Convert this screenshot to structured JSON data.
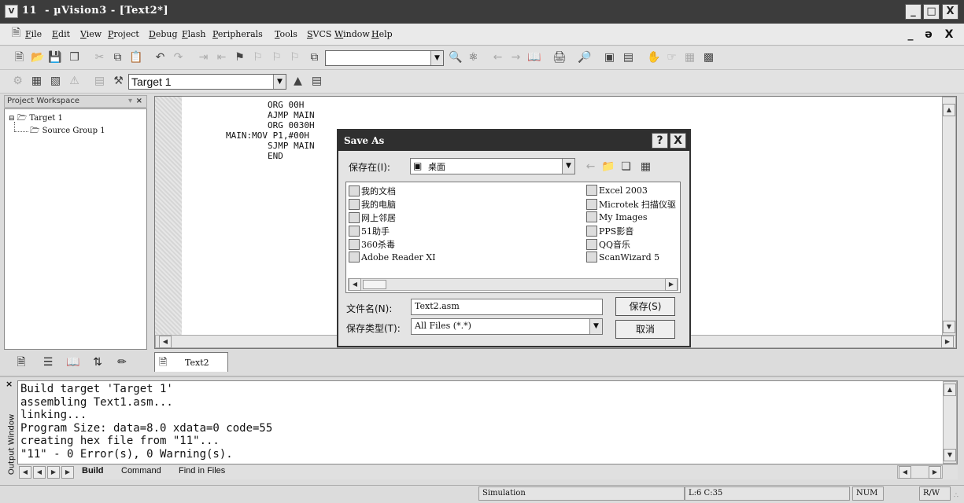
{
  "app": {
    "title": "11  - µVision3 - [Text2*]",
    "icon": "uvision-app-icon"
  },
  "window_controls": {
    "minimize": "_",
    "maximize": "□",
    "close": "X"
  },
  "menu": {
    "items": [
      "File",
      "Edit",
      "View",
      "Project",
      "Debug",
      "Flash",
      "Peripherals",
      "Tools",
      "SVCS",
      "Window",
      "Help"
    ],
    "mdi_controls": {
      "minimize": "_",
      "restore": "ə",
      "close": "X"
    }
  },
  "toolbar2": {
    "target_value": "Target 1"
  },
  "workspace": {
    "header": "Project Workspace",
    "tree": {
      "root": "Target 1",
      "child": "Source Group 1"
    },
    "tabs": [
      "files-tab",
      "regs-tab",
      "books-tab",
      "functions-tab",
      "templates-tab"
    ]
  },
  "editor": {
    "code": [
      "        ORG 00H",
      "        AJMP MAIN",
      "        ORG 0030H",
      "MAIN:MOV P1,#00H",
      "        SJMP MAIN",
      "        END"
    ],
    "doc_tab": "Text2"
  },
  "save_dialog": {
    "title": "Save As",
    "title_help": "?",
    "title_close": "X",
    "look_in_label": "保存在(I):",
    "look_in_value": "桌面",
    "left_items": [
      "我的文档",
      "我的电脑",
      "网上邻居",
      "51助手",
      "360杀毒",
      "Adobe Reader XI"
    ],
    "right_items": [
      "Excel 2003",
      "Microtek 扫描仪驱",
      "My Images",
      "PPS影音",
      "QQ音乐",
      "ScanWizard 5"
    ],
    "filename_label": "文件名(N):",
    "filename_value": "Text2.asm",
    "filetype_label": "保存类型(T):",
    "filetype_value": "All Files (*.*)",
    "save_button": "保存(S)",
    "cancel_button": "取消"
  },
  "output": {
    "side_label": "Output Window",
    "lines": [
      "Build target 'Target 1'",
      "assembling Text1.asm...",
      "linking...",
      "Program Size: data=8.0 xdata=0 code=55",
      "creating hex file from \"11\"...",
      "\"11\" - 0 Error(s), 0 Warning(s)."
    ],
    "tabs": [
      "Build",
      "Command",
      "Find in Files"
    ]
  },
  "status": {
    "mode": "Simulation",
    "position": "L:6 C:35",
    "num": "NUM",
    "rw": "R/W"
  }
}
